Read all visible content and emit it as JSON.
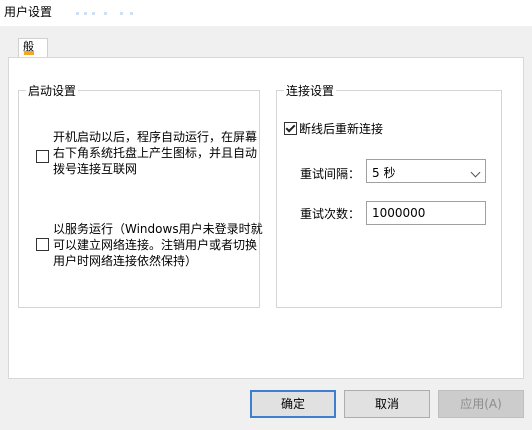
{
  "window": {
    "title": "用户设置"
  },
  "tabs": [
    {
      "label": "般"
    }
  ],
  "startup_group": {
    "legend": "启动设置",
    "autostart_label": "开机启动以后，程序自动运行，在屏幕右下角系统托盘上产生图标，并且自动拨号连接互联网",
    "autostart_checked": false,
    "service_label": "以服务运行（Windows用户未登录时就可以建立网络连接。注销用户或者切换用户时网络连接依然保持）",
    "service_checked": false
  },
  "connection_group": {
    "legend": "连接设置",
    "reconnect_label": "断线后重新连接",
    "reconnect_checked": true,
    "retry_interval_label": "重试间隔：",
    "retry_interval_value": "5 秒",
    "retry_count_label": "重试次数：",
    "retry_count_value": "1000000"
  },
  "buttons": {
    "ok": "确定",
    "cancel": "取消",
    "apply": "应用(A)"
  },
  "colors": {
    "ok_border": "#3c7fd1",
    "tab_icon": "#f5a623"
  }
}
